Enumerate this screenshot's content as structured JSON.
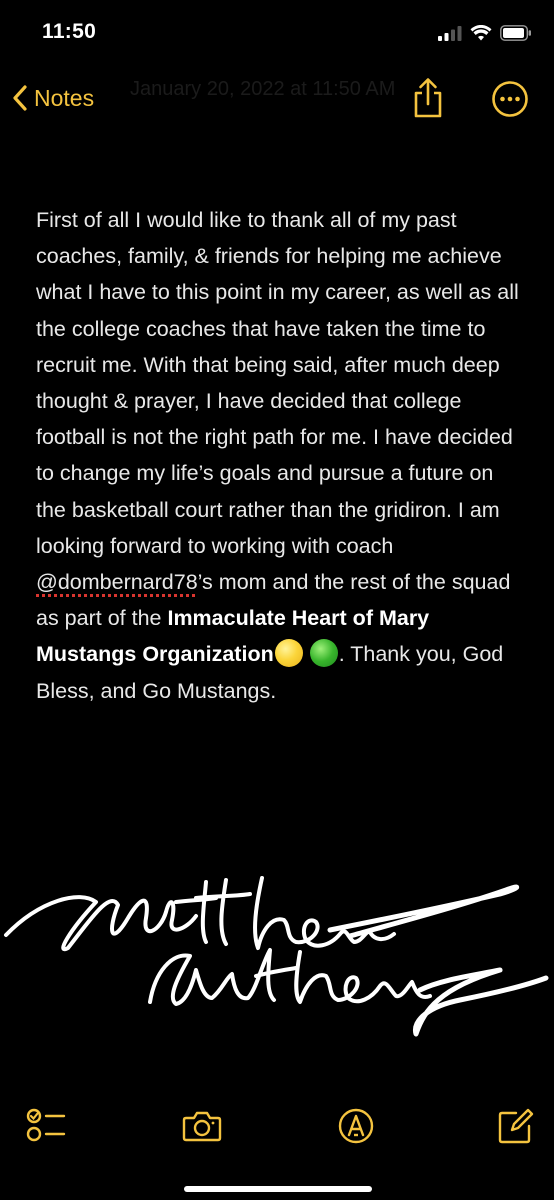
{
  "status_bar": {
    "time": "11:50"
  },
  "nav": {
    "back_label": "Notes",
    "ghost_date": "January 20, 2022 at 11:50 AM",
    "accent_color": "#f4c33f"
  },
  "note": {
    "paragraph_plain": "First of all I would like to thank all of my past coaches, family, & friends for helping me achieve what I have to this point in my career, as well as all the college coaches that have taken the time to recruit me. With that being said, after much deep thought & prayer, I have decided that college football is not the right path for me. I have decided to change my life’s goals and pursue a future on the basketball court rather than the gridiron. I am looking forward to working with coach ",
    "mention": "@dombernard78",
    "after_mention": "’s mom and the rest of the squad as part of the ",
    "bold_text": "Immaculate Heart of Mary Mustangs Organization",
    "closing": ". Thank you, God Bless, and Go Mustangs.",
    "emoji": [
      "yellow-circle",
      "green-circle"
    ]
  },
  "signature": {
    "text": "Matthew Anthony"
  },
  "toolbar": {
    "items": [
      "checklist-icon",
      "camera-icon",
      "markup-icon",
      "compose-icon"
    ]
  }
}
